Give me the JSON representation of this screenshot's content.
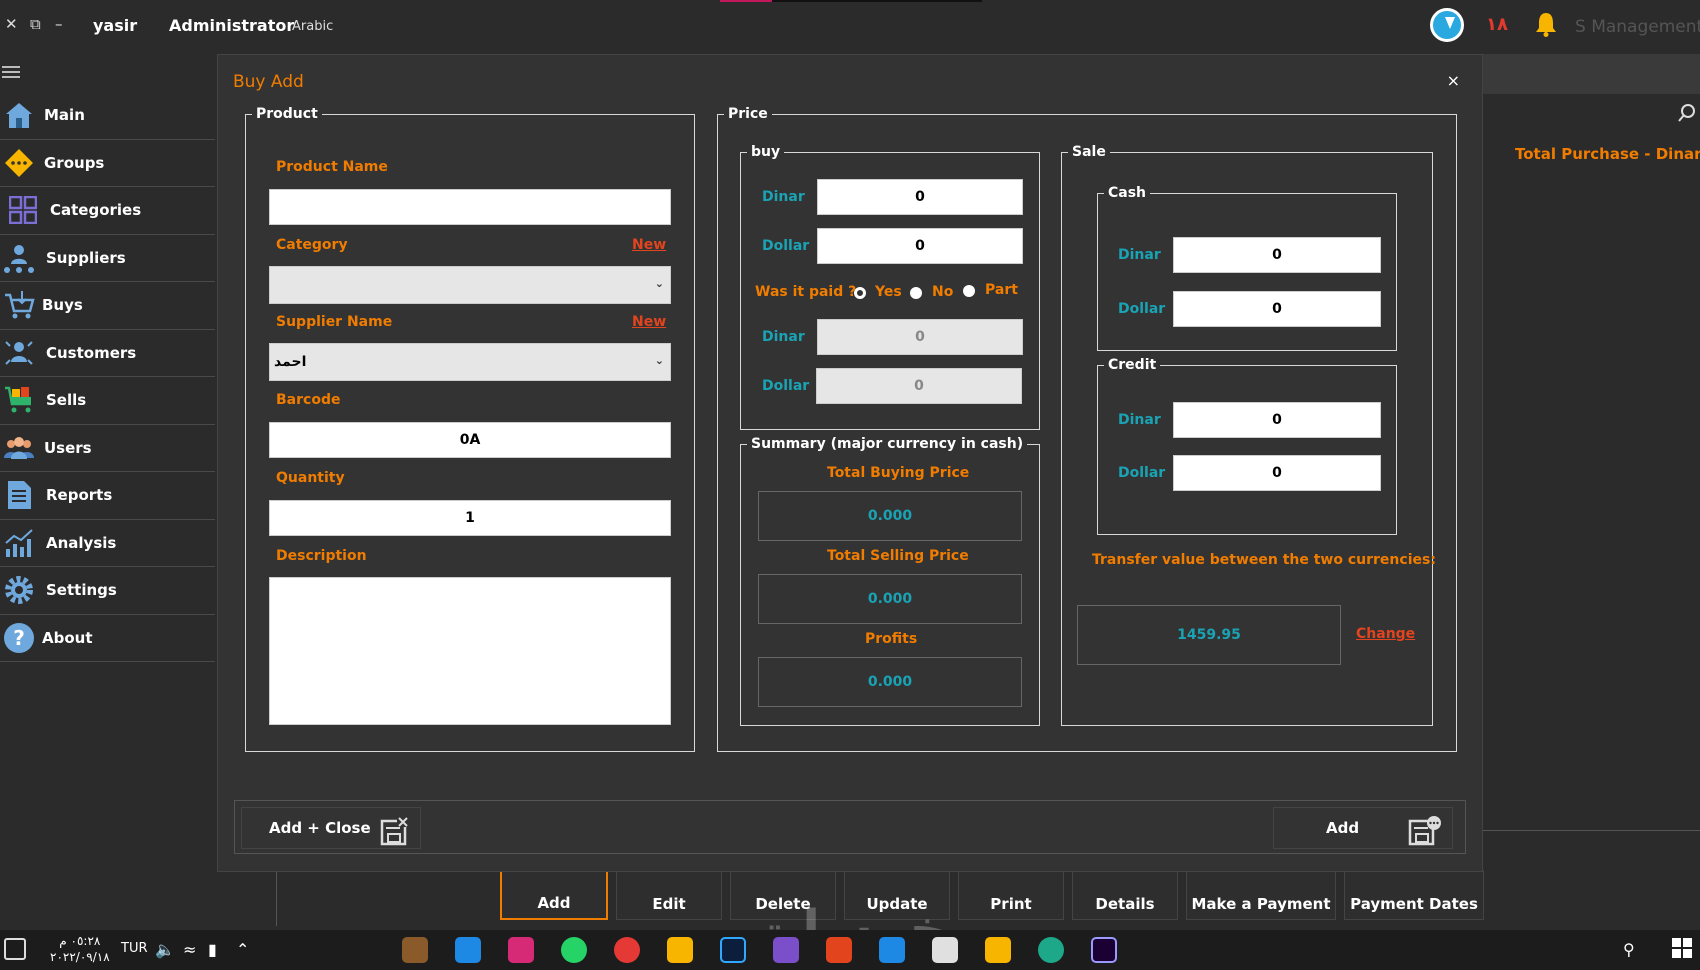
{
  "topbar": {
    "close": "✕",
    "restore": "⧉",
    "minimize": "–",
    "user": "yasir",
    "role": "Administrator",
    "language": "Arabic",
    "notification_count": "١٨",
    "app_name": "S Management"
  },
  "sidebar": {
    "items": [
      {
        "label": "Main"
      },
      {
        "label": "Groups"
      },
      {
        "label": "Categories"
      },
      {
        "label": "Suppliers"
      },
      {
        "label": "Buys"
      },
      {
        "label": "Customers"
      },
      {
        "label": "Sells"
      },
      {
        "label": "Users"
      },
      {
        "label": "Reports"
      },
      {
        "label": "Analysis"
      },
      {
        "label": "Settings"
      },
      {
        "label": "About"
      }
    ]
  },
  "background": {
    "total_purchase": "Total Purchase - Dinar",
    "bottom_buttons": [
      "Add",
      "Edit",
      "Delete",
      "Update",
      "Print",
      "Details",
      "Make a Payment",
      "Payment Dates"
    ]
  },
  "dialog": {
    "title": "Buy Add",
    "close": "×",
    "product": {
      "legend": "Product",
      "product_name_label": "Product Name",
      "product_name_value": "",
      "category_label": "Category",
      "category_new": "New",
      "category_value": "",
      "supplier_label": "Supplier Name",
      "supplier_new": "New",
      "supplier_value": "احمد",
      "barcode_label": "Barcode",
      "barcode_value": "0A",
      "quantity_label": "Quantity",
      "quantity_value": "1",
      "description_label": "Description",
      "description_value": ""
    },
    "price": {
      "legend": "Price",
      "buy": {
        "legend": "buy",
        "dinar_label": "Dinar",
        "dinar_value": "0",
        "dollar_label": "Dollar",
        "dollar_value": "0",
        "paid_question": "Was it paid ?",
        "yes": "Yes",
        "no": "No",
        "part": "Part",
        "paid_dinar_label": "Dinar",
        "paid_dinar_value": "0",
        "paid_dollar_label": "Dollar",
        "paid_dollar_value": "0"
      },
      "summary": {
        "legend": "Summary (major currency in cash)",
        "total_buying_label": "Total Buying Price",
        "total_buying_value": "0.000",
        "total_selling_label": "Total Selling Price",
        "total_selling_value": "0.000",
        "profits_label": "Profits",
        "profits_value": "0.000"
      },
      "sale": {
        "legend": "Sale",
        "cash_legend": "Cash",
        "cash_dinar_label": "Dinar",
        "cash_dinar_value": "0",
        "cash_dollar_label": "Dollar",
        "cash_dollar_value": "0",
        "credit_legend": "Credit",
        "credit_dinar_label": "Dinar",
        "credit_dinar_value": "0",
        "credit_dollar_label": "Dollar",
        "credit_dollar_value": "0",
        "transfer_label": "Transfer value between the two currencies:",
        "transfer_value": "1459.95",
        "change": "Change"
      }
    },
    "footer": {
      "add_close": "Add + Close",
      "add": "Add"
    }
  },
  "taskbar": {
    "time": "٠٥:٢٨ م",
    "date": "٢٠٢٢/٠٩/١٨",
    "lang": "TUR"
  },
  "watermark": "خمسات",
  "colors": {
    "accent_orange": "#f07c00",
    "accent_teal": "#19a3b4",
    "link_red": "#e2441e",
    "dialog_bg": "#333333"
  }
}
